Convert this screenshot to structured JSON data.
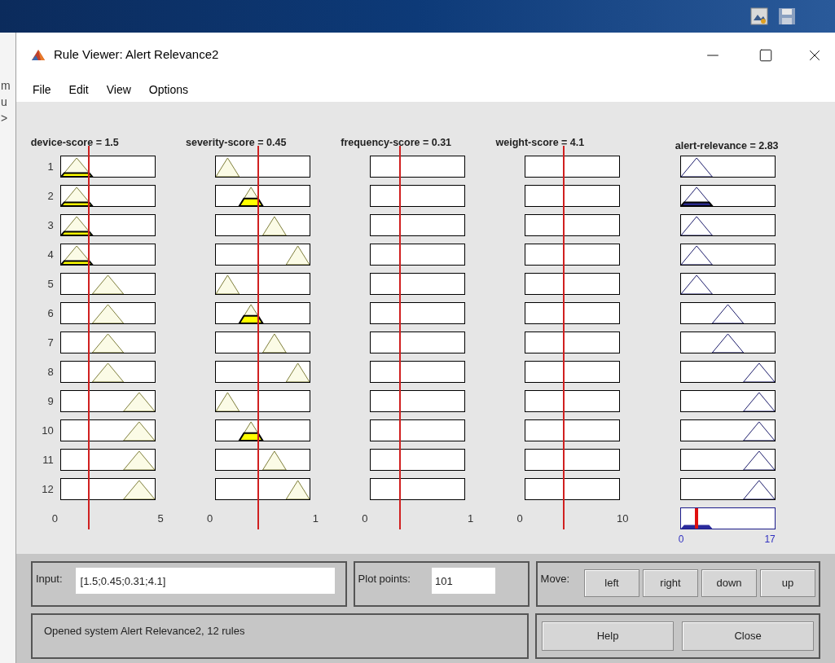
{
  "background_window_fragments": [
    "m",
    "u",
    ">"
  ],
  "window": {
    "title": "Rule Viewer: Alert Relevance2"
  },
  "menu": [
    "File",
    "Edit",
    "View",
    "Options"
  ],
  "inputs": [
    {
      "label": "device-score = 1.5",
      "level": 0.3,
      "kind": "three-terms",
      "ticks": [
        "0",
        "5"
      ]
    },
    {
      "label": "severity-score = 0.45",
      "level": 0.45,
      "kind": "four-terms",
      "ticks": [
        "0",
        "1"
      ]
    },
    {
      "label": "frequency-score = 0.31",
      "level": 0.31,
      "ticks": [
        "0",
        "1"
      ]
    },
    {
      "label": "weight-score = 4.1",
      "level": 0.41,
      "ticks": [
        "0",
        "10"
      ]
    }
  ],
  "output": {
    "label": "alert-relevance = 2.83",
    "level": 0.17,
    "kind": "three-terms",
    "ticks": [
      "0",
      "17"
    ]
  },
  "rules": [
    {
      "number": "1",
      "cells": [
        {
          "kind": "term1"
        },
        {
          "kind": "term1"
        },
        {
          "kind": "empty"
        },
        {
          "kind": "empty"
        },
        {
          "kind": "term1"
        }
      ]
    },
    {
      "number": "2",
      "cells": [
        {
          "kind": "term1"
        },
        {
          "kind": "term2"
        },
        {
          "kind": "empty"
        },
        {
          "kind": "empty"
        },
        {
          "kind": "term1"
        }
      ]
    },
    {
      "number": "3",
      "cells": [
        {
          "kind": "term1"
        },
        {
          "kind": "term3"
        },
        {
          "kind": "empty"
        },
        {
          "kind": "empty"
        },
        {
          "kind": "term1"
        }
      ]
    },
    {
      "number": "4",
      "cells": [
        {
          "kind": "term1"
        },
        {
          "kind": "term4"
        },
        {
          "kind": "empty"
        },
        {
          "kind": "empty"
        },
        {
          "kind": "term1"
        }
      ]
    },
    {
      "number": "5",
      "cells": [
        {
          "kind": "term2"
        },
        {
          "kind": "term1"
        },
        {
          "kind": "empty"
        },
        {
          "kind": "empty"
        },
        {
          "kind": "term1"
        }
      ]
    },
    {
      "number": "6",
      "cells": [
        {
          "kind": "term2"
        },
        {
          "kind": "term2"
        },
        {
          "kind": "empty"
        },
        {
          "kind": "empty"
        },
        {
          "kind": "term2"
        }
      ]
    },
    {
      "number": "7",
      "cells": [
        {
          "kind": "term2"
        },
        {
          "kind": "term3"
        },
        {
          "kind": "empty"
        },
        {
          "kind": "empty"
        },
        {
          "kind": "term2"
        }
      ]
    },
    {
      "number": "8",
      "cells": [
        {
          "kind": "term2"
        },
        {
          "kind": "term4"
        },
        {
          "kind": "empty"
        },
        {
          "kind": "empty"
        },
        {
          "kind": "term3"
        }
      ]
    },
    {
      "number": "9",
      "cells": [
        {
          "kind": "term3"
        },
        {
          "kind": "term1"
        },
        {
          "kind": "empty"
        },
        {
          "kind": "empty"
        },
        {
          "kind": "term3"
        }
      ]
    },
    {
      "number": "10",
      "cells": [
        {
          "kind": "term3"
        },
        {
          "kind": "term2"
        },
        {
          "kind": "empty"
        },
        {
          "kind": "empty"
        },
        {
          "kind": "term3"
        }
      ]
    },
    {
      "number": "11",
      "cells": [
        {
          "kind": "term3"
        },
        {
          "kind": "term3"
        },
        {
          "kind": "empty"
        },
        {
          "kind": "empty"
        },
        {
          "kind": "term3"
        }
      ]
    },
    {
      "number": "12",
      "cells": [
        {
          "kind": "term3"
        },
        {
          "kind": "term4"
        },
        {
          "kind": "empty"
        },
        {
          "kind": "empty"
        },
        {
          "kind": "term3"
        }
      ]
    }
  ],
  "input_panel": {
    "label": "Input:",
    "value": "[1.5;0.45;0.31;4.1]"
  },
  "plot_points": {
    "label": "Plot points:",
    "value": "101"
  },
  "move": {
    "label": "Move:",
    "buttons": [
      "left",
      "right",
      "down",
      "up"
    ]
  },
  "status": "Opened system Alert Relevance2, 12 rules",
  "buttons": [
    "Help",
    "Close"
  ]
}
